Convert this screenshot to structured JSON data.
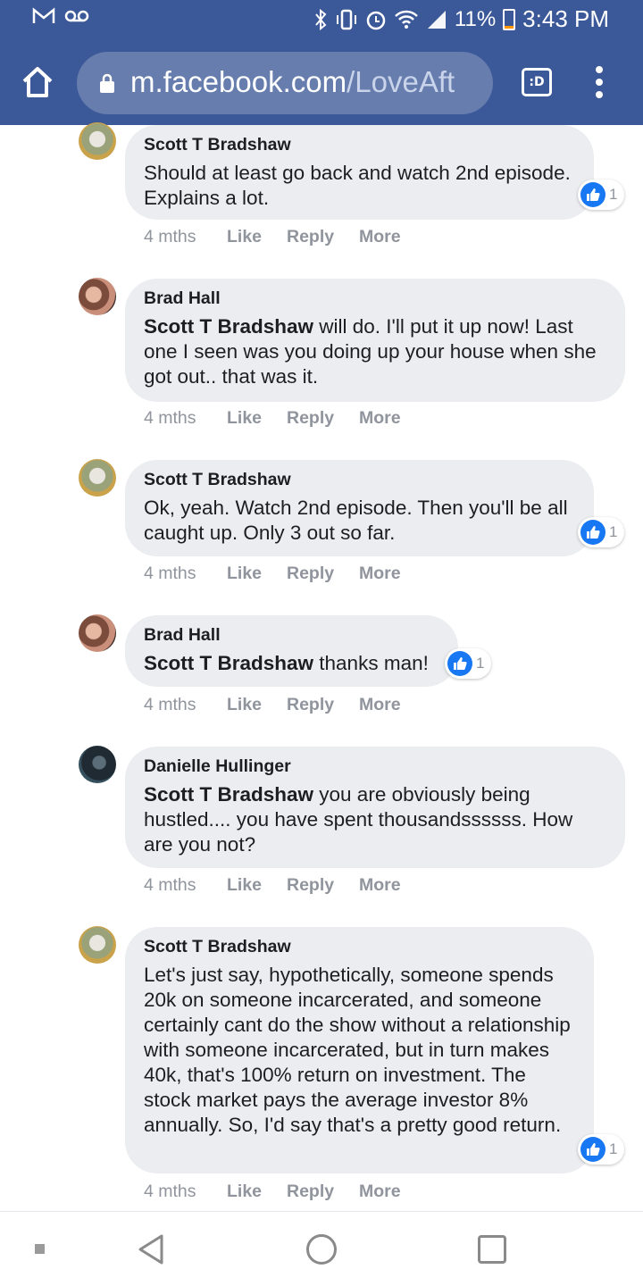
{
  "status_bar": {
    "left_icons": [
      "gmail-icon",
      "voicemail-icon"
    ],
    "right_icons": [
      "bluetooth-icon",
      "vibrate-icon",
      "alarm-icon",
      "wifi-icon",
      "signal-icon"
    ],
    "battery": "11%",
    "battery_level": 0.11,
    "time": "3:43 PM"
  },
  "browser": {
    "url_host": "m.facebook.com",
    "url_path": "/LoveAft",
    "tab_label": ":D",
    "icons": [
      "home-icon",
      "lock-icon",
      "tabs-icon",
      "menu-icon"
    ]
  },
  "theme": {
    "facebook_blue": "#3b5998",
    "like_blue": "#1877f2",
    "bubble_gray": "#ebedf0"
  },
  "comments": [
    {
      "author": "Scott T Bradshaw",
      "mention": "",
      "text": "Should at least go back and watch 2nd episode. Explains a lot.",
      "time": "4 mths",
      "like": "Like",
      "reply": "Reply",
      "more": "More",
      "reactions": "1"
    },
    {
      "author": "Brad Hall",
      "mention": "Scott T Bradshaw",
      "text": " will do. I'll put it up now! Last one I seen was you doing up your house when she got out.. that was it.",
      "time": "4 mths",
      "like": "Like",
      "reply": "Reply",
      "more": "More",
      "reactions": ""
    },
    {
      "author": "Scott T Bradshaw",
      "mention": "",
      "text": "Ok, yeah. Watch 2nd episode. Then you'll be all caught up. Only 3 out so far.",
      "time": "4 mths",
      "like": "Like",
      "reply": "Reply",
      "more": "More",
      "reactions": "1"
    },
    {
      "author": "Brad Hall",
      "mention": "Scott T Bradshaw",
      "text": " thanks man!",
      "time": "4 mths",
      "like": "Like",
      "reply": "Reply",
      "more": "More",
      "reactions": "1"
    },
    {
      "author": "Danielle Hullinger",
      "mention": "Scott T Bradshaw",
      "text": " you are obviously being hustled.... you have spent thousandssssss. How are you not?",
      "time": "4 mths",
      "like": "Like",
      "reply": "Reply",
      "more": "More",
      "reactions": ""
    },
    {
      "author": "Scott T Bradshaw",
      "mention": "",
      "text": "Let's just say, hypothetically, someone spends 20k on someone incarcerated, and someone certainly cant do the show without a relationship with someone incarcerated, but in turn makes 40k, that's 100% return on investment. The stock market pays the average investor 8% annually. So, I'd say that's a pretty good return.",
      "time": "4 mths",
      "like": "Like",
      "reply": "Reply",
      "more": "More",
      "reactions": "1"
    }
  ],
  "nav_bar": {
    "icons": [
      "menu-dot-icon",
      "back-icon",
      "home-circle-icon",
      "recents-icon"
    ]
  }
}
